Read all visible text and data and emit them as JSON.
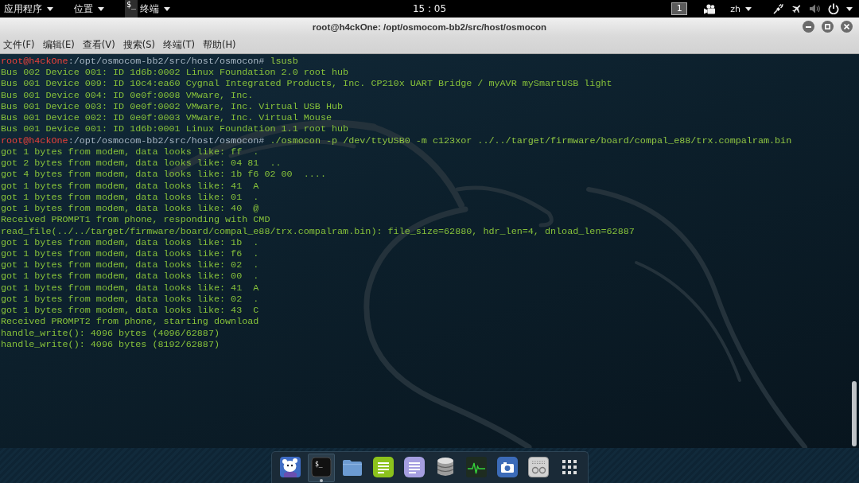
{
  "top_panel": {
    "menus": [
      "应用程序",
      "位置"
    ],
    "app_menu": {
      "icon_text": "$_",
      "label": "终端"
    },
    "clock": "15 : 05",
    "workspace": "1",
    "input_method": "zh"
  },
  "window": {
    "title": "root@h4ckOne: /opt/osmocom-bb2/src/host/osmocon",
    "menu": [
      "文件(F)",
      "编辑(E)",
      "查看(V)",
      "搜索(S)",
      "终端(T)",
      "帮助(H)"
    ]
  },
  "terminal": {
    "lines": [
      {
        "kind": "prompt",
        "user": "root@h4ckOne",
        "path": ":/opt/osmocom-bb2/src/host/osmocon#",
        "command": "lsusb"
      },
      {
        "kind": "output",
        "text": "Bus 002 Device 001: ID 1d6b:0002 Linux Foundation 2.0 root hub"
      },
      {
        "kind": "output",
        "text": "Bus 001 Device 009: ID 10c4:ea60 Cygnal Integrated Products, Inc. CP210x UART Bridge / myAVR mySmartUSB light"
      },
      {
        "kind": "output",
        "text": "Bus 001 Device 004: ID 0e0f:0008 VMware, Inc."
      },
      {
        "kind": "output",
        "text": "Bus 001 Device 003: ID 0e0f:0002 VMware, Inc. Virtual USB Hub"
      },
      {
        "kind": "output",
        "text": "Bus 001 Device 002: ID 0e0f:0003 VMware, Inc. Virtual Mouse"
      },
      {
        "kind": "output",
        "text": "Bus 001 Device 001: ID 1d6b:0001 Linux Foundation 1.1 root hub"
      },
      {
        "kind": "prompt",
        "user": "root@h4ckOne",
        "path": ":/opt/osmocom-bb2/src/host/osmocon#",
        "command": "./osmocon -p /dev/ttyUSB0 -m c123xor ../../target/firmware/board/compal_e88/trx.compalram.bin"
      },
      {
        "kind": "output",
        "text": "got 1 bytes from modem, data looks like: ff  ."
      },
      {
        "kind": "output",
        "text": "got 2 bytes from modem, data looks like: 04 81  .."
      },
      {
        "kind": "output",
        "text": "got 4 bytes from modem, data looks like: 1b f6 02 00  ...."
      },
      {
        "kind": "output",
        "text": "got 1 bytes from modem, data looks like: 41  A"
      },
      {
        "kind": "output",
        "text": "got 1 bytes from modem, data looks like: 01  ."
      },
      {
        "kind": "output",
        "text": "got 1 bytes from modem, data looks like: 40  @"
      },
      {
        "kind": "output",
        "text": "Received PROMPT1 from phone, responding with CMD"
      },
      {
        "kind": "output",
        "text": "read_file(../../target/firmware/board/compal_e88/trx.compalram.bin): file_size=62880, hdr_len=4, dnload_len=62887"
      },
      {
        "kind": "output",
        "text": "got 1 bytes from modem, data looks like: 1b  ."
      },
      {
        "kind": "output",
        "text": "got 1 bytes from modem, data looks like: f6  ."
      },
      {
        "kind": "output",
        "text": "got 1 bytes from modem, data looks like: 02  ."
      },
      {
        "kind": "output",
        "text": "got 1 bytes from modem, data looks like: 00  ."
      },
      {
        "kind": "output",
        "text": "got 1 bytes from modem, data looks like: 41  A"
      },
      {
        "kind": "output",
        "text": "got 1 bytes from modem, data looks like: 02  ."
      },
      {
        "kind": "output",
        "text": "got 1 bytes from modem, data looks like: 43  C"
      },
      {
        "kind": "output",
        "text": "Received PROMPT2 from phone, starting download"
      },
      {
        "kind": "output",
        "text": "handle_write(): 4096 bytes (4096/62887)"
      },
      {
        "kind": "output",
        "text": "handle_write(): 4096 bytes (8192/62887)"
      }
    ]
  },
  "dock": {
    "items": [
      {
        "kind": "mascot",
        "selected": false,
        "running": false
      },
      {
        "kind": "terminal",
        "glyph": "$_",
        "selected": true,
        "running": true
      },
      {
        "kind": "folder",
        "selected": false,
        "running": false
      },
      {
        "kind": "notes",
        "selected": false,
        "running": false
      },
      {
        "kind": "editor",
        "selected": false,
        "running": false
      },
      {
        "kind": "database",
        "selected": false,
        "running": false
      },
      {
        "kind": "monitor",
        "selected": false,
        "running": false
      },
      {
        "kind": "camera",
        "selected": false,
        "running": false
      },
      {
        "kind": "radio",
        "selected": false,
        "running": false
      },
      {
        "kind": "grid",
        "selected": false,
        "running": false
      }
    ]
  }
}
